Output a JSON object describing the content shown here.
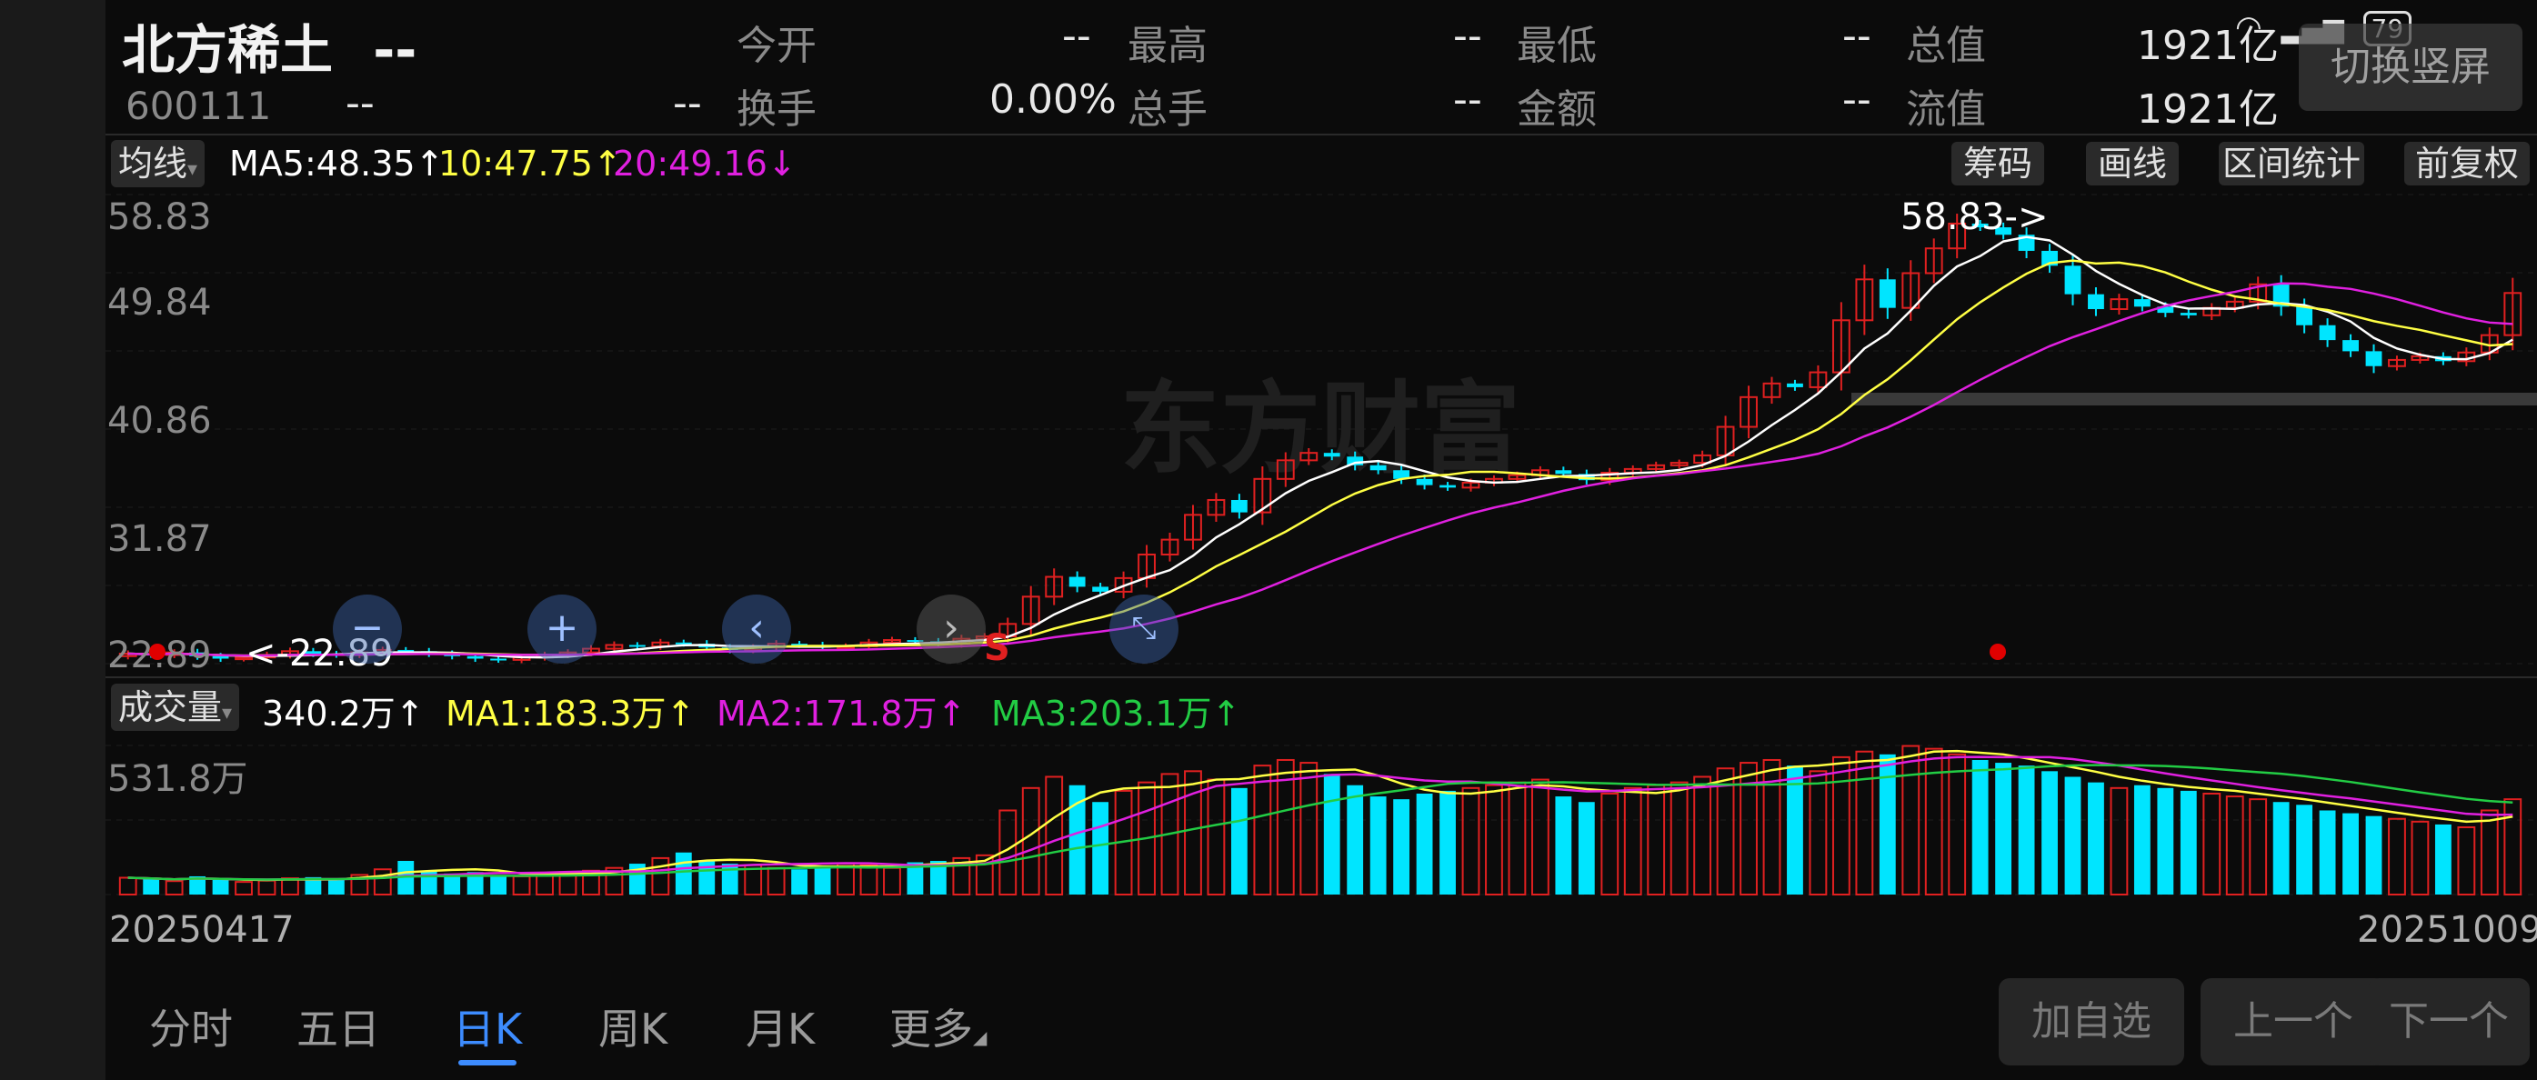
{
  "status_bar": {
    "battery": "79"
  },
  "header": {
    "name": "北方稀土",
    "name_suffix": "--",
    "code": "600111",
    "code_val1": "--",
    "code_val2": "--",
    "fields": [
      {
        "label": "今开",
        "value": "--"
      },
      {
        "label": "最高",
        "value": "--"
      },
      {
        "label": "最低",
        "value": "--"
      },
      {
        "label": "总值",
        "value": "1921亿"
      },
      {
        "label": "换手",
        "value": "0.00%"
      },
      {
        "label": "总手",
        "value": "--"
      },
      {
        "label": "金额",
        "value": "--"
      },
      {
        "label": "流值",
        "value": "1921亿"
      }
    ],
    "switch_button": "切换竖屏"
  },
  "toolbar": {
    "ma_selector": "均线",
    "ma5": "MA5:48.35↑",
    "ma10": "10:47.75↑",
    "ma20": "20:49.16↓",
    "buttons": [
      "筹码",
      "画线",
      "区间统计",
      "前复权"
    ]
  },
  "price_axis": [
    "58.83",
    "49.84",
    "40.86",
    "31.87",
    "22.89"
  ],
  "annotations": {
    "high": "58.83->",
    "low": "<-22.89",
    "s_marker": "S"
  },
  "watermark": "东方财富",
  "volume_bar": {
    "selector": "成交量",
    "vol": "340.2万↑",
    "ma1": "MA1:183.3万↑",
    "ma2": "MA2:171.8万↑",
    "ma3": "MA3:203.1万↑",
    "max_label": "531.8万"
  },
  "dates": {
    "start": "20250417",
    "end": "20251009"
  },
  "tabs": [
    "分时",
    "五日",
    "日K",
    "周K",
    "月K",
    "更多"
  ],
  "active_tab": "日K",
  "footer_buttons": [
    "加自选",
    "上一个",
    "下一个"
  ],
  "colors": {
    "up": "#e02020",
    "down": "#00e5ff",
    "ma5": "#ffffff",
    "ma10": "#ffff44",
    "ma20": "#e020e0",
    "ma3": "#22cc44",
    "accent": "#3d8cff"
  },
  "chart_data": {
    "type": "candlestick",
    "ylim": [
      22.89,
      58.83
    ],
    "x_start": "20250417",
    "x_end": "20251009",
    "closes": [
      23.4,
      23.3,
      23.5,
      23.2,
      23.0,
      23.1,
      23.3,
      23.6,
      23.4,
      23.3,
      23.5,
      23.7,
      23.6,
      23.4,
      23.2,
      23.0,
      22.9,
      23.1,
      23.3,
      23.5,
      23.8,
      24.1,
      24.0,
      24.3,
      24.2,
      23.9,
      23.7,
      23.9,
      24.2,
      24.1,
      23.9,
      24.0,
      24.3,
      24.5,
      24.4,
      24.2,
      24.6,
      24.8,
      25.8,
      28.0,
      29.6,
      28.8,
      28.4,
      29.5,
      31.4,
      32.6,
      34.6,
      35.8,
      34.8,
      37.5,
      39.0,
      39.6,
      39.3,
      38.6,
      38.2,
      37.5,
      37.0,
      36.8,
      37.2,
      37.5,
      37.8,
      38.2,
      37.9,
      37.4,
      38.0,
      38.3,
      38.6,
      38.8,
      39.4,
      41.7,
      44.1,
      45.2,
      44.9,
      46.1,
      50.3,
      53.6,
      51.3,
      54.1,
      56.1,
      58.1,
      57.8,
      57.2,
      55.9,
      54.7,
      52.4,
      51.2,
      52.0,
      51.4,
      50.9,
      50.7,
      51.3,
      51.8,
      53.2,
      51.4,
      49.9,
      48.7,
      47.8,
      46.6,
      47.1,
      47.4,
      47.0,
      47.7,
      49.1,
      52.5
    ],
    "vol_max": 531.8,
    "volumes": [
      60,
      55,
      48,
      65,
      52,
      45,
      50,
      58,
      62,
      55,
      70,
      90,
      120,
      85,
      75,
      80,
      70,
      65,
      72,
      80,
      85,
      95,
      110,
      130,
      150,
      120,
      110,
      105,
      95,
      90,
      100,
      110,
      105,
      95,
      115,
      120,
      130,
      140,
      300,
      380,
      420,
      390,
      330,
      370,
      400,
      430,
      440,
      410,
      380,
      460,
      480,
      470,
      430,
      390,
      350,
      340,
      360,
      370,
      380,
      390,
      400,
      410,
      350,
      330,
      360,
      380,
      390,
      400,
      420,
      450,
      470,
      480,
      460,
      440,
      490,
      510,
      500,
      530,
      520,
      500,
      480,
      470,
      460,
      440,
      420,
      400,
      380,
      390,
      380,
      370,
      360,
      350,
      340,
      330,
      320,
      300,
      290,
      280,
      270,
      260,
      250,
      240,
      300,
      340
    ]
  }
}
